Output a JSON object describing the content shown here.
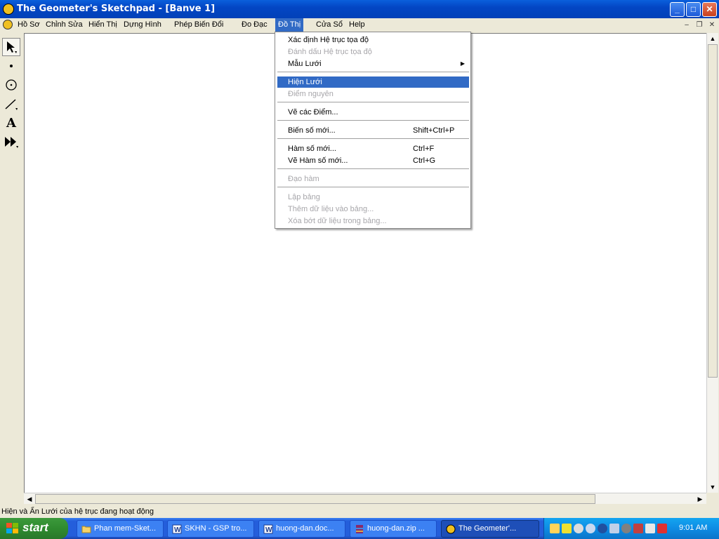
{
  "window": {
    "title": "The Geometer's Sketchpad - [Banve 1]",
    "controls": {
      "minimize": "_",
      "maximize": "□",
      "close": "✕"
    }
  },
  "menubar": {
    "items": [
      "Hồ Sơ",
      "Chỉnh Sửa",
      "Hiển Thị",
      "Dựng Hình",
      "Phép Biến Đổi",
      "Đo Đạc",
      "Đồ Thị",
      "Cửa Sổ",
      "Help"
    ],
    "mdi_controls": {
      "minimize": "–",
      "restore": "❐",
      "close": "✕"
    }
  },
  "dropdown": {
    "items": [
      {
        "label": "Xác định Hệ trục tọa độ",
        "state": "normal"
      },
      {
        "label": "Đánh dấu Hệ trục tọa độ",
        "state": "disabled"
      },
      {
        "label": "Mẫu Lưới",
        "state": "normal",
        "submenu": "▶"
      },
      {
        "label": "Hiện Lưới",
        "state": "highlighted"
      },
      {
        "label": "Điểm nguyên",
        "state": "disabled"
      },
      {
        "label": "Vẽ các Điểm...",
        "state": "normal"
      },
      {
        "label": "Biến số mới...",
        "state": "normal",
        "shortcut": "Shift+Ctrl+P"
      },
      {
        "label": "Hàm số mới...",
        "state": "normal",
        "shortcut": "Ctrl+F"
      },
      {
        "label": "Vẽ Hàm số mới...",
        "state": "normal",
        "shortcut": "Ctrl+G"
      },
      {
        "label": "Đạo hàm",
        "state": "disabled"
      },
      {
        "label": "Lập bảng",
        "state": "disabled"
      },
      {
        "label": "Thêm dữ liệu vào bảng...",
        "state": "disabled"
      },
      {
        "label": "Xóa bớt dữ liệu trong bảng...",
        "state": "disabled"
      }
    ]
  },
  "toolbox": {
    "tools": [
      "selection-arrow",
      "point",
      "compass",
      "straightedge",
      "text",
      "custom-tool"
    ],
    "text_tool_label": "A"
  },
  "status_text": "Hiện và Ẩn Lưới của hệ trục đang hoạt động",
  "taskbar": {
    "start_label": "start",
    "tasks": [
      {
        "label": "Phan mem-Sket...",
        "icon": "folder-icon"
      },
      {
        "label": "SKHN - GSP tro...",
        "icon": "word-icon"
      },
      {
        "label": "huong-dan.doc...",
        "icon": "word-icon"
      },
      {
        "label": "huong-dan.zip ...",
        "icon": "winrar-icon"
      },
      {
        "label": "The Geometer'...",
        "icon": "sketchpad-icon"
      }
    ],
    "clock": "9:01 AM"
  },
  "colors": {
    "highlight": "#316ac5",
    "titlebar": "#0346c4",
    "taskbar": "#245edb",
    "start": "#2f8b2f"
  }
}
